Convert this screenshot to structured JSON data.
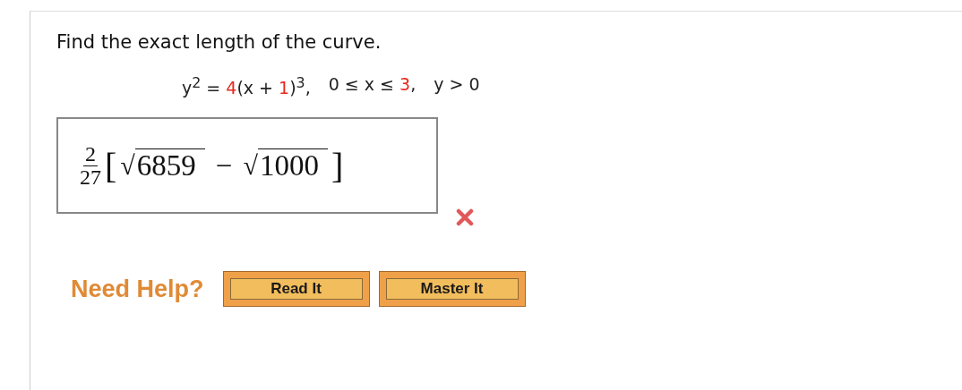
{
  "question": {
    "prompt": "Find the exact length of the curve.",
    "equation": [
      [
        {
          "text": "y$^{2}$ = ",
          "highlight": false
        },
        {
          "text": "4",
          "highlight": true
        },
        {
          "text": "(x + ",
          "highlight": false
        },
        {
          "text": "1",
          "highlight": true
        },
        {
          "text": ")$^{3}$,",
          "highlight": false
        }
      ],
      [
        {
          "text": "0 ≤ x ≤ ",
          "highlight": false
        },
        {
          "text": "3",
          "highlight": true
        },
        {
          "text": ",",
          "highlight": false
        }
      ],
      [
        {
          "text": "y > 0",
          "highlight": false
        }
      ]
    ]
  },
  "answer": {
    "numerator": "2",
    "denominator": "27",
    "open_bracket": "[",
    "terms": [
      {
        "radical": "√",
        "radicand": "6859"
      },
      {
        "operator": "−",
        "radical": "√",
        "radicand": "1000"
      }
    ],
    "close_bracket": "]",
    "correct": false
  },
  "help": {
    "label": "Need Help?",
    "buttons": [
      "Read It",
      "Master It"
    ]
  }
}
